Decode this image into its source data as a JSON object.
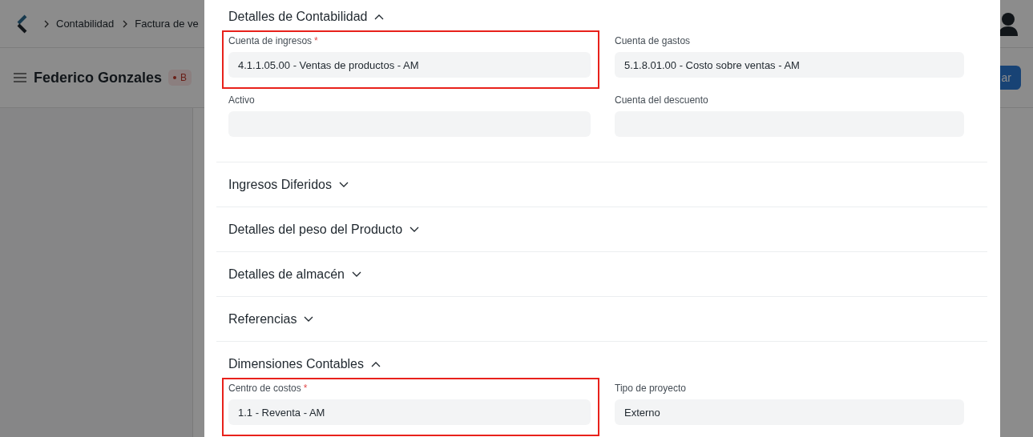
{
  "navbar": {
    "breadcrumbs": [
      "Contabilidad",
      "Factura de ve"
    ]
  },
  "page_header": {
    "title": "Federico Gonzales",
    "status_badge": "B",
    "primary_button": "ar"
  },
  "dialog": {
    "sections": [
      {
        "title": "Detalles de Contabilidad",
        "expanded": true,
        "fields": [
          {
            "label": "Cuenta de ingresos",
            "required_mark": "*",
            "value": "4.1.1.05.00 - Ventas de productos - AM",
            "highlighted": true
          },
          {
            "label": "Cuenta de gastos",
            "value": "5.1.8.01.00 - Costo sobre ventas - AM",
            "highlighted": false
          },
          {
            "label": "Activo",
            "highlighted": false
          },
          {
            "label": "Cuenta del descuento",
            "highlighted": false
          }
        ]
      },
      {
        "title": "Ingresos Diferidos",
        "expanded": false
      },
      {
        "title": "Detalles del peso del Producto",
        "expanded": false
      },
      {
        "title": "Detalles de almacén",
        "expanded": false
      },
      {
        "title": "Referencias",
        "expanded": false
      },
      {
        "title": "Dimensiones Contables",
        "expanded": true,
        "fields": [
          {
            "label": "Centro de costos",
            "required_mark": "*",
            "value": "1.1 - Reventa - AM",
            "highlighted": true
          },
          {
            "label": "Tipo de proyecto",
            "value": "Externo",
            "highlighted": false
          }
        ]
      }
    ]
  }
}
